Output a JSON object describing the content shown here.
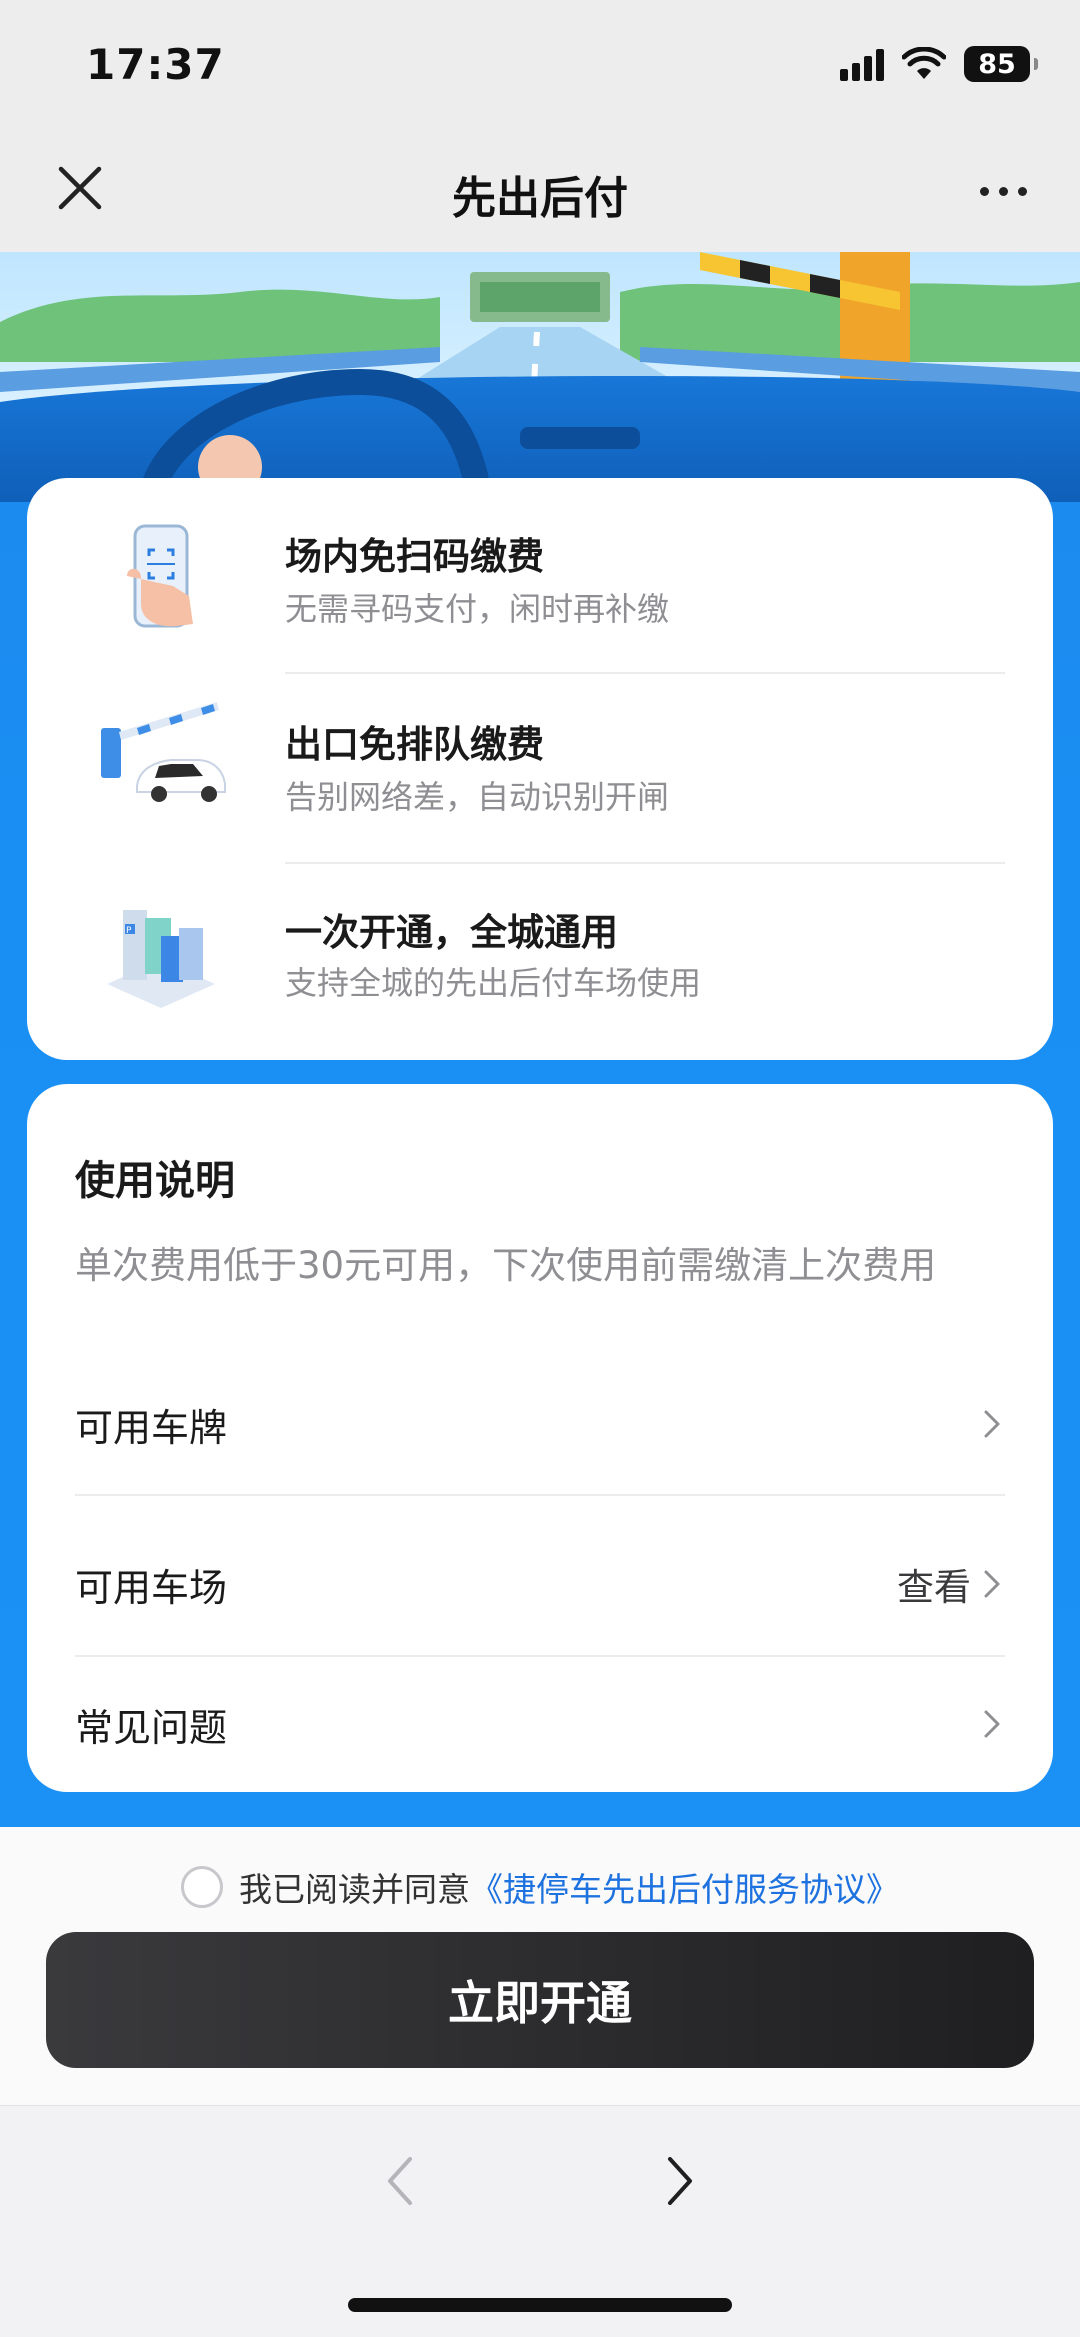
{
  "status_bar": {
    "time": "17:37",
    "battery": "85",
    "icons": [
      "signal-icon",
      "wifi-icon",
      "battery-icon"
    ]
  },
  "nav": {
    "title": "先出后付",
    "close_icon": "close-icon",
    "more_icon": "more-icon"
  },
  "colors": {
    "accent_blue": "#1b90f5",
    "link_blue": "#1d72e0",
    "button_dark": "#262628"
  },
  "features": [
    {
      "title": "场内免扫码缴费",
      "subtitle": "无需寻码支付，闲时再补缴",
      "icon": "phone-scan-icon"
    },
    {
      "title": "出口免排队缴费",
      "subtitle": "告别网络差，自动识别开闸",
      "icon": "gate-car-icon"
    },
    {
      "title": "一次开通，全城通用",
      "subtitle": "支持全城的先出后付车场使用",
      "icon": "city-buildings-icon"
    }
  ],
  "info": {
    "heading": "使用说明",
    "description": "单次费用低于30元可用，下次使用前需缴清上次费用",
    "rows": [
      {
        "label": "可用车牌",
        "value": ""
      },
      {
        "label": "可用车场",
        "value": "查看"
      },
      {
        "label": "常见问题",
        "value": ""
      }
    ]
  },
  "agreement": {
    "prefix": "我已阅读并同意",
    "link": "《捷停车先出后付服务协议》",
    "checked": false
  },
  "cta": {
    "label": "立即开通"
  },
  "browser": {
    "back_icon": "chevron-left-icon",
    "forward_icon": "chevron-right-icon"
  }
}
